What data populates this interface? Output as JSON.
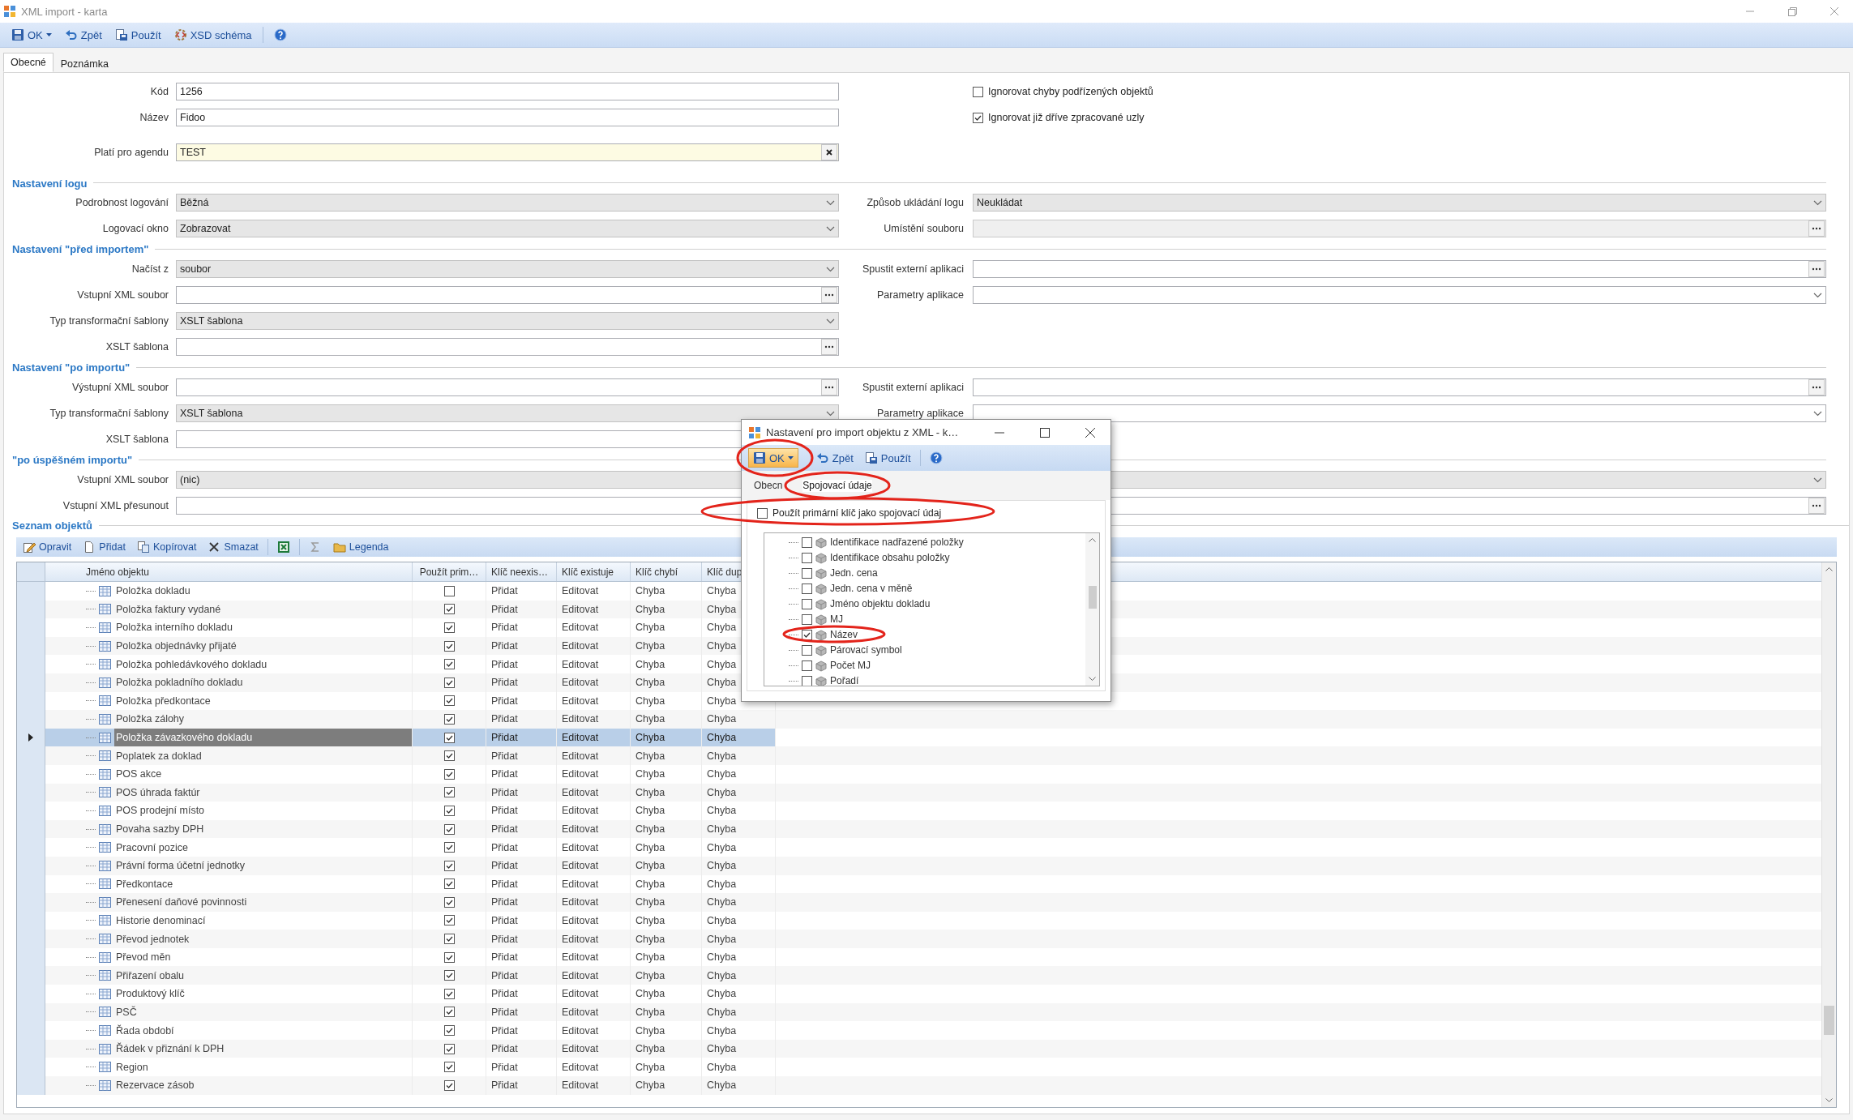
{
  "window": {
    "title": "XML import - karta"
  },
  "toolbar": [
    {
      "kind": "save",
      "label": "OK",
      "dropdown": true
    },
    {
      "kind": "undo",
      "label": "Zpět"
    },
    {
      "kind": "apply",
      "label": "Použít"
    },
    {
      "kind": "schema",
      "label": "XSD schéma"
    },
    {
      "kind": "help"
    }
  ],
  "tabs": [
    {
      "label": "Obecné",
      "selected": true
    },
    {
      "label": "Poznámka",
      "selected": false
    }
  ],
  "form": {
    "rows": [
      {
        "left": {
          "label": "Kód",
          "kind": "text",
          "value": "1256"
        },
        "right": {
          "kind": "checkbox",
          "label": "Ignorovat chyby podřízených objektů",
          "checked": false
        }
      },
      {
        "left": {
          "label": "Název",
          "kind": "text",
          "value": "Fidoo"
        },
        "right": {
          "kind": "checkbox",
          "label": "Ignorovat již dříve zpracované uzly",
          "checked": true
        }
      },
      {
        "left": {
          "label": "Platí pro agendu",
          "kind": "lookup",
          "value": "TEST"
        }
      }
    ],
    "sections": [
      {
        "title": "Nastavení logu",
        "rows": [
          {
            "left": {
              "label": "Podrobnost logování",
              "kind": "combo",
              "value": "Běžná"
            },
            "right": {
              "label": "Způsob ukládání logu",
              "kind": "combo",
              "value": "Neukládat"
            }
          },
          {
            "left": {
              "label": "Logovací okno",
              "kind": "combo",
              "value": "Zobrazovat"
            },
            "right": {
              "label": "Umístění souboru",
              "kind": "browse",
              "disabled": true
            }
          }
        ]
      },
      {
        "title": "Nastavení \"před importem\"",
        "rows": [
          {
            "left": {
              "label": "Načíst z",
              "kind": "combo",
              "value": "soubor"
            },
            "right": {
              "label": "Spustit externí aplikaci",
              "kind": "browse"
            }
          },
          {
            "left": {
              "label": "Vstupní XML soubor",
              "kind": "browse"
            },
            "right": {
              "label": "Parametry aplikace",
              "kind": "editcombo"
            }
          },
          {
            "left": {
              "label": "Typ transformační šablony",
              "kind": "combo",
              "value": "XSLT šablona"
            }
          },
          {
            "left": {
              "label": "XSLT šablona",
              "kind": "browse"
            }
          }
        ]
      },
      {
        "title": "Nastavení \"po importu\"",
        "rows": [
          {
            "left": {
              "label": "Výstupní XML soubor",
              "kind": "browse"
            },
            "right": {
              "label": "Spustit externí aplikaci",
              "kind": "browse"
            }
          },
          {
            "left": {
              "label": "Typ transformační šablony",
              "kind": "combo",
              "value": "XSLT šablona"
            },
            "right": {
              "label": "Parametry aplikace",
              "kind": "editcombo"
            }
          },
          {
            "left": {
              "label": "XSLT šablona",
              "kind": "text"
            }
          }
        ]
      },
      {
        "title": "\"po úspěšném importu\"",
        "rows": [
          {
            "wide": true,
            "left": {
              "label": "Vstupní XML soubor",
              "kind": "combo",
              "value": "(nic)"
            }
          },
          {
            "wide": true,
            "left": {
              "label": "Vstupní XML přesunout",
              "kind": "browse"
            }
          }
        ]
      }
    ]
  },
  "objects": {
    "title": "Seznam objektů",
    "toolbar": [
      {
        "kind": "edit",
        "label": "Opravit"
      },
      {
        "kind": "new",
        "label": "Přidat"
      },
      {
        "kind": "copy",
        "label": "Kopírovat"
      },
      {
        "kind": "delete",
        "label": "Smazat"
      },
      {
        "kind": "excel"
      },
      {
        "kind": "sum"
      },
      {
        "kind": "legend",
        "label": "Legenda"
      }
    ],
    "columns": [
      "Jméno objektu",
      "Použít prim…",
      "Klíč neexis…",
      "Klíč existuje",
      "Klíč chybí",
      "Klíč dup"
    ],
    "rows": [
      {
        "selected": false,
        "cells": [
          "Položka dokladu",
          {
            "checked": false
          },
          "Přidat",
          "Editovat",
          "Chyba",
          "Chyba"
        ]
      },
      {
        "selected": false,
        "cells": [
          "Položka faktury vydané",
          {
            "checked": true
          },
          "Přidat",
          "Editovat",
          "Chyba",
          "Chyba"
        ]
      },
      {
        "selected": false,
        "cells": [
          "Položka interního dokladu",
          {
            "checked": true
          },
          "Přidat",
          "Editovat",
          "Chyba",
          "Chyba"
        ]
      },
      {
        "selected": false,
        "cells": [
          "Položka objednávky přijaté",
          {
            "checked": true
          },
          "Přidat",
          "Editovat",
          "Chyba",
          "Chyba"
        ]
      },
      {
        "selected": false,
        "cells": [
          "Položka pohledávkového dokladu",
          {
            "checked": true
          },
          "Přidat",
          "Editovat",
          "Chyba",
          "Chyba"
        ]
      },
      {
        "selected": false,
        "cells": [
          "Položka pokladního dokladu",
          {
            "checked": true
          },
          "Přidat",
          "Editovat",
          "Chyba",
          "Chyba"
        ]
      },
      {
        "selected": false,
        "cells": [
          "Položka předkontace",
          {
            "checked": true
          },
          "Přidat",
          "Editovat",
          "Chyba",
          "Chyba"
        ]
      },
      {
        "selected": false,
        "cells": [
          "Položka zálohy",
          {
            "checked": true
          },
          "Přidat",
          "Editovat",
          "Chyba",
          "Chyba"
        ]
      },
      {
        "selected": true,
        "cells": [
          "Položka závazkového dokladu",
          {
            "checked": true
          },
          "Přidat",
          "Editovat",
          "Chyba",
          "Chyba"
        ]
      },
      {
        "selected": false,
        "cells": [
          "Poplatek za doklad",
          {
            "checked": true
          },
          "Přidat",
          "Editovat",
          "Chyba",
          "Chyba"
        ]
      },
      {
        "selected": false,
        "cells": [
          "POS akce",
          {
            "checked": true
          },
          "Přidat",
          "Editovat",
          "Chyba",
          "Chyba"
        ]
      },
      {
        "selected": false,
        "cells": [
          "POS úhrada faktúr",
          {
            "checked": true
          },
          "Přidat",
          "Editovat",
          "Chyba",
          "Chyba"
        ]
      },
      {
        "selected": false,
        "cells": [
          "POS prodejní místo",
          {
            "checked": true
          },
          "Přidat",
          "Editovat",
          "Chyba",
          "Chyba"
        ]
      },
      {
        "selected": false,
        "cells": [
          "Povaha sazby DPH",
          {
            "checked": true
          },
          "Přidat",
          "Editovat",
          "Chyba",
          "Chyba"
        ]
      },
      {
        "selected": false,
        "cells": [
          "Pracovní pozice",
          {
            "checked": true
          },
          "Přidat",
          "Editovat",
          "Chyba",
          "Chyba"
        ]
      },
      {
        "selected": false,
        "cells": [
          "Právní forma účetní jednotky",
          {
            "checked": true
          },
          "Přidat",
          "Editovat",
          "Chyba",
          "Chyba"
        ]
      },
      {
        "selected": false,
        "cells": [
          "Předkontace",
          {
            "checked": true
          },
          "Přidat",
          "Editovat",
          "Chyba",
          "Chyba"
        ]
      },
      {
        "selected": false,
        "cells": [
          "Přenesení daňové povinnosti",
          {
            "checked": true
          },
          "Přidat",
          "Editovat",
          "Chyba",
          "Chyba"
        ]
      },
      {
        "selected": false,
        "cells": [
          "Historie denominací",
          {
            "checked": true
          },
          "Přidat",
          "Editovat",
          "Chyba",
          "Chyba"
        ]
      },
      {
        "selected": false,
        "cells": [
          "Převod jednotek",
          {
            "checked": true
          },
          "Přidat",
          "Editovat",
          "Chyba",
          "Chyba"
        ]
      },
      {
        "selected": false,
        "cells": [
          "Převod měn",
          {
            "checked": true
          },
          "Přidat",
          "Editovat",
          "Chyba",
          "Chyba"
        ]
      },
      {
        "selected": false,
        "cells": [
          "Přiřazení obalu",
          {
            "checked": true
          },
          "Přidat",
          "Editovat",
          "Chyba",
          "Chyba"
        ]
      },
      {
        "selected": false,
        "cells": [
          "Produktový klíč",
          {
            "checked": true
          },
          "Přidat",
          "Editovat",
          "Chyba",
          "Chyba"
        ]
      },
      {
        "selected": false,
        "cells": [
          "PSČ",
          {
            "checked": true
          },
          "Přidat",
          "Editovat",
          "Chyba",
          "Chyba"
        ]
      },
      {
        "selected": false,
        "cells": [
          "Řada období",
          {
            "checked": true
          },
          "Přidat",
          "Editovat",
          "Chyba",
          "Chyba"
        ]
      },
      {
        "selected": false,
        "cells": [
          "Řádek v přiznání k DPH",
          {
            "checked": true
          },
          "Přidat",
          "Editovat",
          "Chyba",
          "Chyba"
        ]
      },
      {
        "selected": false,
        "cells": [
          "Region",
          {
            "checked": true
          },
          "Přidat",
          "Editovat",
          "Chyba",
          "Chyba"
        ]
      },
      {
        "selected": false,
        "cells": [
          "Rezervace zásob",
          {
            "checked": true
          },
          "Přidat",
          "Editovat",
          "Chyba",
          "Chyba"
        ]
      }
    ]
  },
  "dialog": {
    "title": "Nastavení pro import objektu z XML - k…",
    "toolbar": [
      {
        "kind": "save",
        "label": "OK",
        "dropdown": true,
        "hover": true
      },
      {
        "kind": "undo",
        "label": "Zpět"
      },
      {
        "kind": "apply",
        "label": "Použít"
      },
      {
        "kind": "help"
      }
    ],
    "tabs": [
      {
        "label": "Obecn",
        "selected": false
      },
      {
        "label": "Spojovací údaje",
        "selected": true
      }
    ],
    "use_primary_key": {
      "label": "Použít primární klíč jako spojovací údaj",
      "checked": false
    },
    "fields": [
      {
        "label": "Identifikace nadřazené položky",
        "checked": false
      },
      {
        "label": "Identifikace obsahu položky",
        "checked": false
      },
      {
        "label": "Jedn. cena",
        "checked": false
      },
      {
        "label": "Jedn. cena v měně",
        "checked": false
      },
      {
        "label": "Jméno objektu dokladu",
        "checked": false
      },
      {
        "label": "MJ",
        "checked": false
      },
      {
        "label": "Název",
        "checked": true
      },
      {
        "label": "Párovací symbol",
        "checked": false
      },
      {
        "label": "Počet MJ",
        "checked": false
      },
      {
        "label": "Pořadí",
        "checked": false
      }
    ]
  }
}
